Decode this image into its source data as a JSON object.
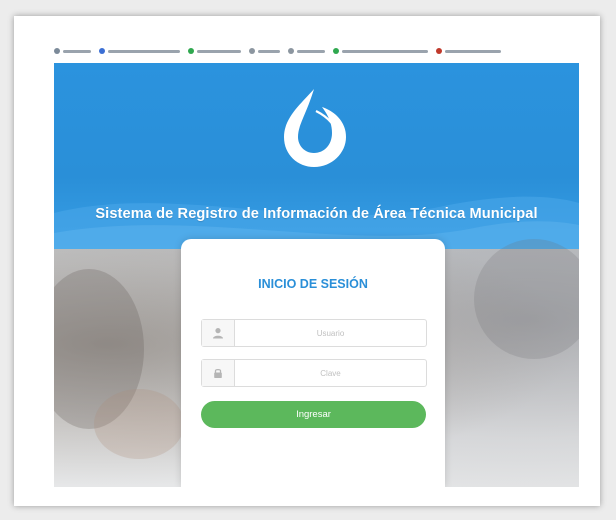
{
  "header": {
    "site_title": "Sistema de Registro de Información de Área Técnica Municipal"
  },
  "login": {
    "title": "INICIO DE SESIÓN",
    "username_placeholder": "Usuario",
    "password_placeholder": "Clave",
    "submit_label": "Ingresar"
  },
  "icons": {
    "logo": "water-drop-logo",
    "user": "user-icon",
    "lock": "lock-icon"
  },
  "colors": {
    "primary_blue": "#2a8fd8",
    "button_green": "#5cb85c"
  }
}
